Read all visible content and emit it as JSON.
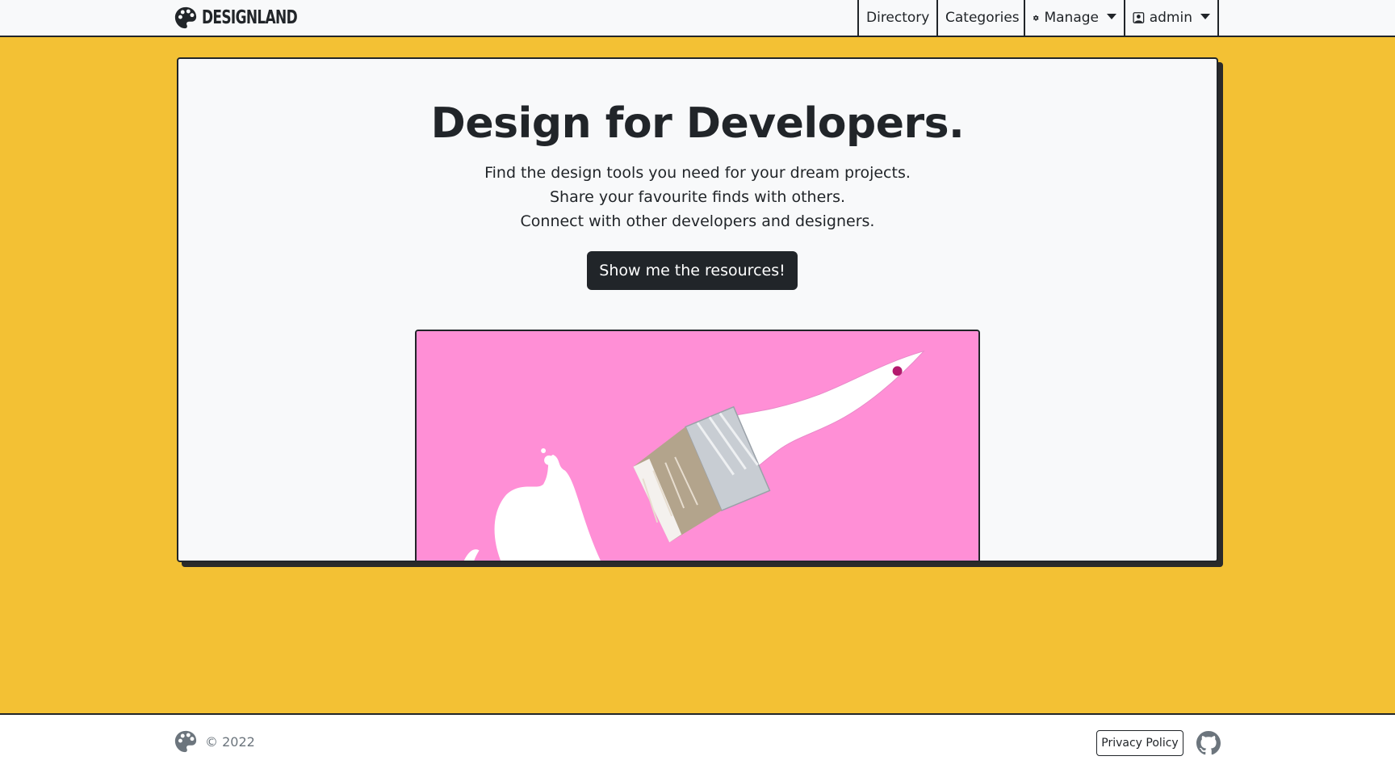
{
  "nav": {
    "brand": "DESIGNLAND",
    "links": {
      "directory": "Directory",
      "categories": "Categories",
      "manage": "Manage",
      "user": "admin"
    }
  },
  "hero": {
    "title": "Design for Developers.",
    "lines": [
      "Find the design tools you need for your dream projects.",
      "Share your favourite finds with others.",
      "Connect with other developers and designers."
    ],
    "cta_label": "Show me the resources!"
  },
  "footer": {
    "copyright": "© 2022",
    "privacy_label": "Privacy Policy"
  },
  "colors": {
    "background": "#f3c134",
    "dark": "#212529",
    "card": "#f8f9fa",
    "image_pink": "#ff8fd6"
  },
  "icons": {
    "brand": "palette-icon",
    "manage": "gear-icon",
    "user": "person-badge-icon",
    "footer_logo": "palette-icon",
    "github": "github-icon"
  }
}
